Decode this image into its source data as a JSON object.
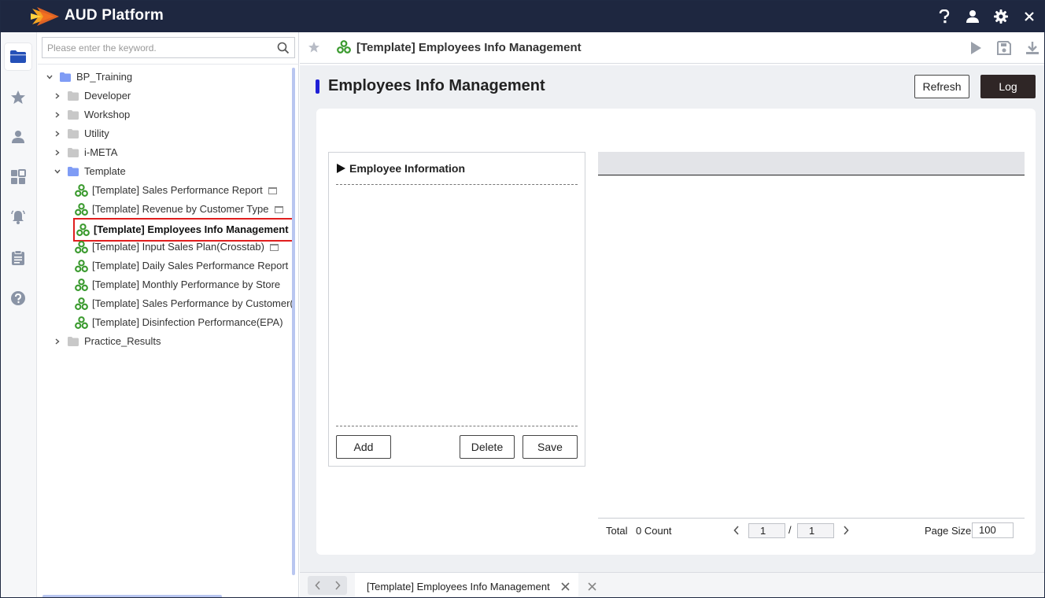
{
  "app": {
    "title": "AUD Platform"
  },
  "explorer": {
    "search_placeholder": "Please enter the keyword.",
    "tree": {
      "root": "BP_Training",
      "folders": {
        "developer": "Developer",
        "workshop": "Workshop",
        "utility": "Utility",
        "imeta": "i-META",
        "template": "Template",
        "practice": "Practice_Results"
      },
      "reports": [
        "[Template] Sales Performance Report",
        "[Template] Revenue by Customer Type",
        "[Template] Employees Info Management",
        "[Template] Input Sales Plan(Crosstab)",
        "[Template] Daily Sales Performance Report",
        "[Template] Monthly Performance by Store",
        "[Template] Sales Performance by Customer(",
        "[Template] Disinfection Performance(EPA)"
      ]
    }
  },
  "content": {
    "tab_title": "[Template] Employees Info Management",
    "report_title": "Employees Info Management",
    "refresh_label": "Refresh",
    "log_label": "Log",
    "employee_panel": {
      "heading": "Employee Information",
      "add_label": "Add",
      "delete_label": "Delete",
      "save_label": "Save"
    },
    "pager": {
      "total_label": "Total",
      "count_text": "0 Count",
      "current_page": "1",
      "slash": "/",
      "total_pages": "1",
      "page_size_label": "Page Size",
      "page_size": "100"
    }
  },
  "bottom_tabs": {
    "active_tab": "[Template] Employees Info Management"
  },
  "colors": {
    "topbar": "#1e2740",
    "accent_bar": "#1f1fd6",
    "selected_outline": "#e01e1e",
    "report_icon": "#3a9a2e",
    "folder": "#7f9cf5",
    "log_button": "#2f2626"
  },
  "icons": {
    "top": [
      "help-icon",
      "user-icon",
      "gear-icon",
      "close-icon"
    ],
    "rail": [
      "folder-icon",
      "star-icon",
      "person-icon",
      "dashboard-icon",
      "bell-icon",
      "clipboard-icon",
      "question-icon"
    ],
    "content_actions": [
      "play-icon",
      "save-icon",
      "download-icon"
    ]
  }
}
